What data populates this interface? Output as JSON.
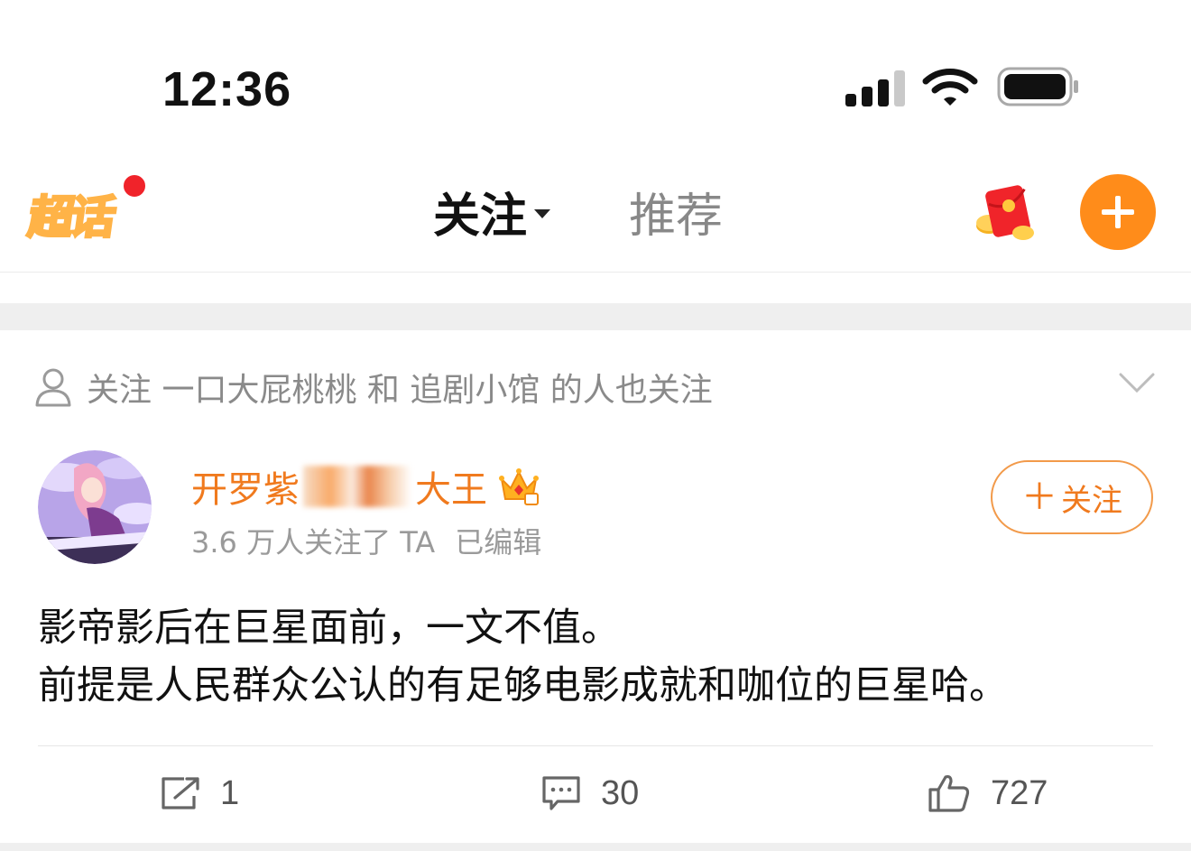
{
  "status_bar": {
    "time": "12:36"
  },
  "topnav": {
    "logo_text": "超话",
    "tabs": [
      {
        "label": "关注",
        "active": true
      },
      {
        "label": "推荐",
        "active": false
      }
    ],
    "accent_color": "#ff8c1a"
  },
  "post": {
    "recommendation_text": "关注 一口大屁桃桃 和 追剧小馆 的人也关注",
    "author": {
      "name_prefix": "开罗紫",
      "name_suffix": "大王",
      "followers_text": "3.6 万人关注了 TA",
      "edited_text": "已编辑"
    },
    "follow_button": {
      "plus": "＋",
      "label": "关注"
    },
    "content_lines": [
      "影帝影后在巨星面前，一文不值。",
      "前提是人民群众公认的有足够电影成就和咖位的巨星哈。"
    ],
    "actions": {
      "share_count": "1",
      "comment_count": "30",
      "like_count": "727"
    }
  }
}
